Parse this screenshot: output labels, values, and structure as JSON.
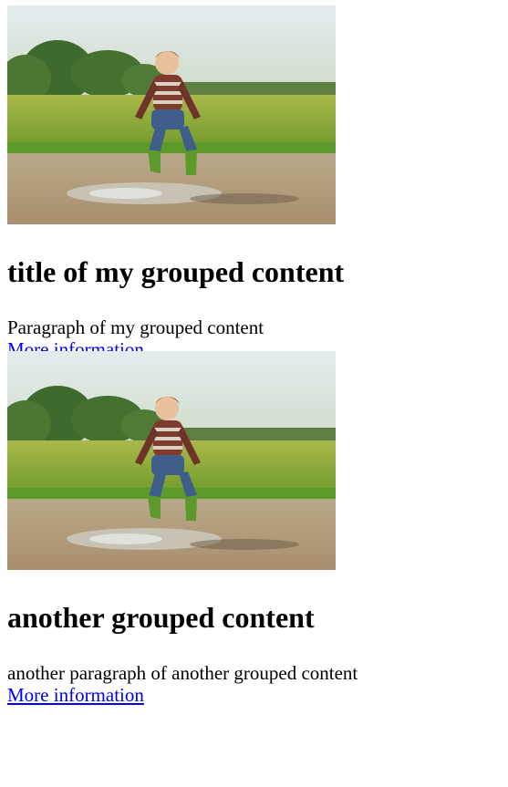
{
  "groups": [
    {
      "image": {
        "alt": ""
      },
      "title": "title of my grouped content",
      "paragraph": "Paragraph of my grouped content",
      "link_text": "More information"
    },
    {
      "image": {
        "alt": ""
      },
      "title": "another grouped content",
      "paragraph": "another paragraph of another grouped content",
      "link_text": "More information"
    }
  ],
  "colors": {
    "link": "#0000ee",
    "text": "#000000",
    "background": "#ffffff"
  }
}
